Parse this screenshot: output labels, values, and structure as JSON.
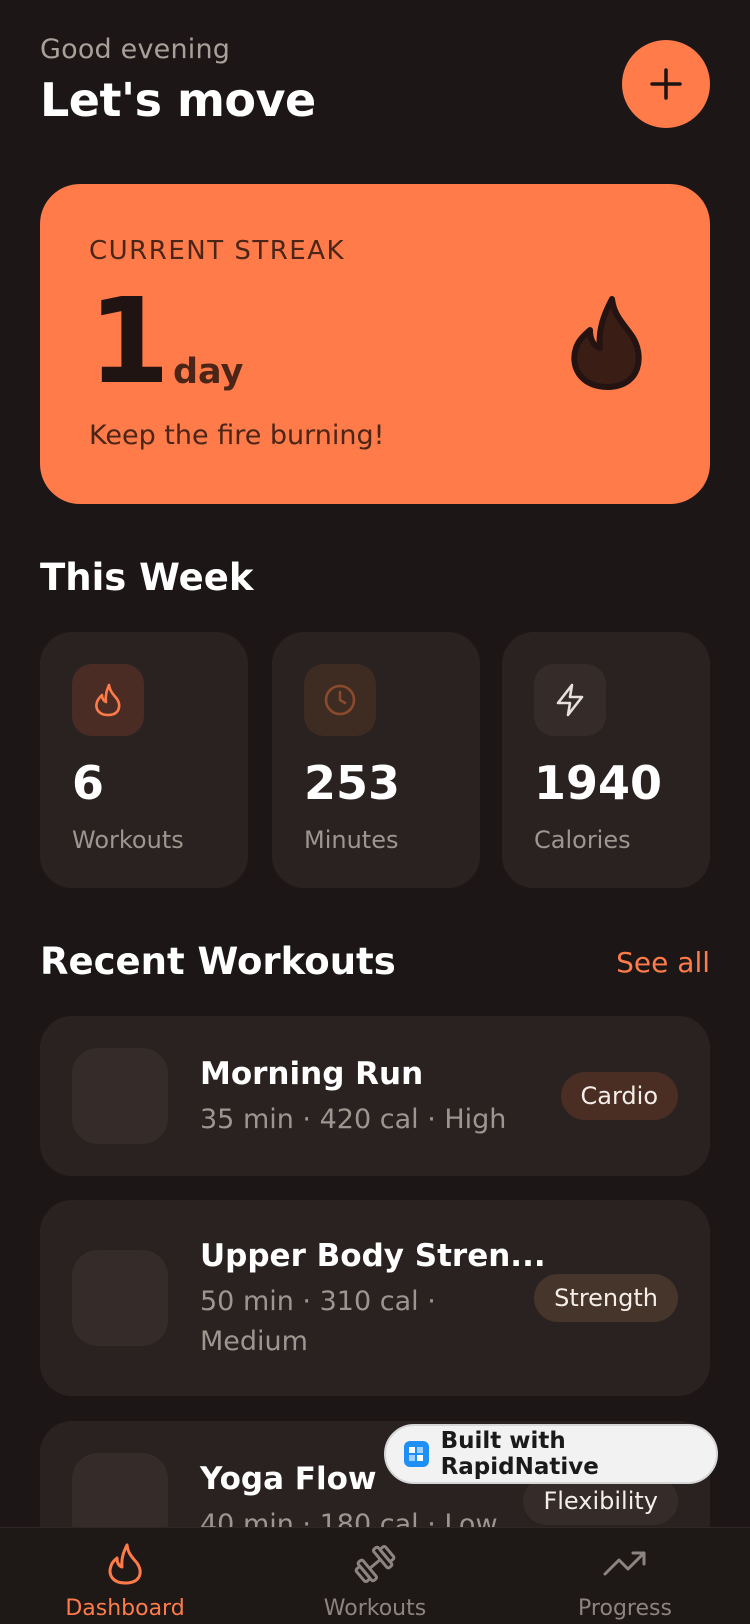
{
  "header": {
    "greeting": "Good evening",
    "title": "Let's move"
  },
  "streak": {
    "label": "CURRENT STREAK",
    "count": "1",
    "unit": "day",
    "subtitle": "Keep the fire burning!"
  },
  "week": {
    "title": "This Week",
    "stats": [
      {
        "value": "6",
        "label": "Workouts",
        "icon": "flame-icon"
      },
      {
        "value": "253",
        "label": "Minutes",
        "icon": "clock-icon"
      },
      {
        "value": "1940",
        "label": "Calories",
        "icon": "lightning-icon"
      }
    ]
  },
  "recent": {
    "title": "Recent Workouts",
    "see_all": "See all",
    "items": [
      {
        "name": "Morning Run",
        "meta": "35 min · 420 cal · High",
        "tag": "Cardio"
      },
      {
        "name": "Upper Body Stren...",
        "meta_line1": "50 min · 310 cal ·",
        "meta_line2": "Medium",
        "tag": "Strength"
      },
      {
        "name": "Yoga Flow",
        "meta": "40 min · 180 cal · Low",
        "tag": "Flexibility"
      }
    ]
  },
  "badge": {
    "text": "Built with RapidNative"
  },
  "tabs": [
    {
      "label": "Dashboard",
      "icon": "flame-icon",
      "active": true
    },
    {
      "label": "Workouts",
      "icon": "dumbbell-icon",
      "active": false
    },
    {
      "label": "Progress",
      "icon": "trending-up-icon",
      "active": false
    }
  ],
  "colors": {
    "accent": "#ff7b4a",
    "background": "#1c1716",
    "card": "#2a2220",
    "muted_text": "#9f9590"
  }
}
